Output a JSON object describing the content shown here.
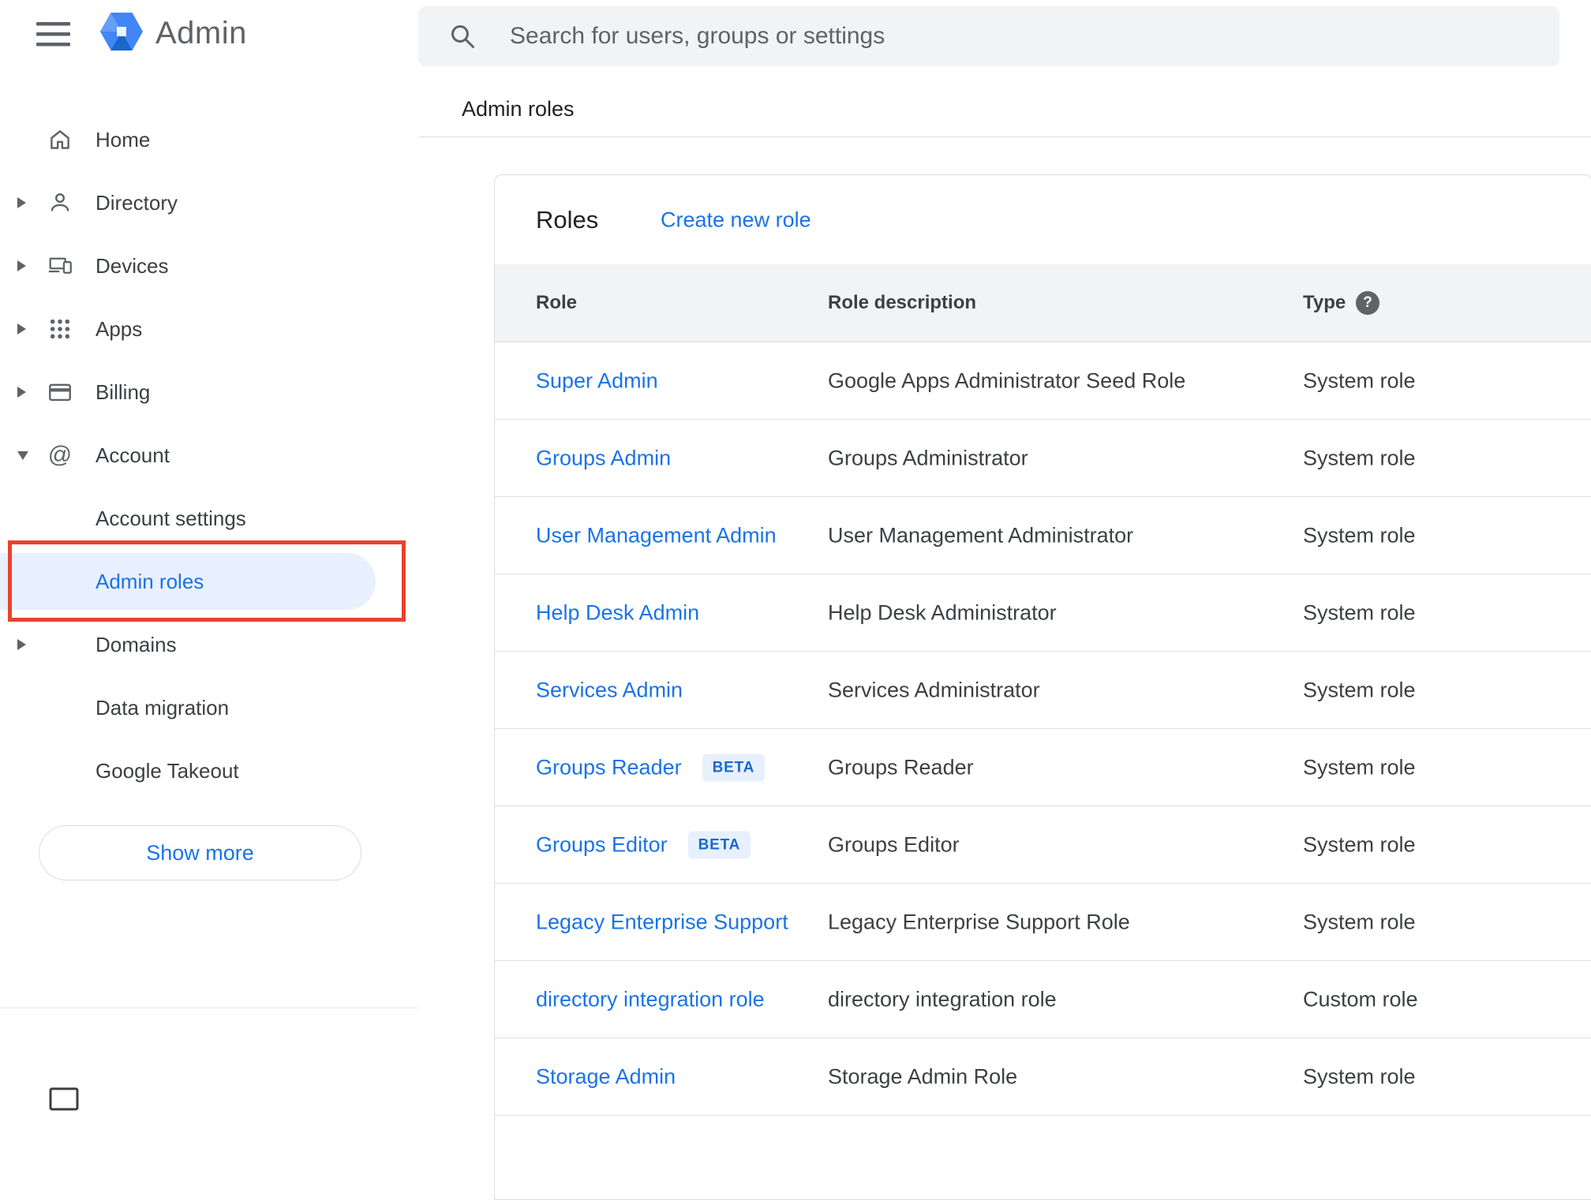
{
  "app": {
    "product_name": "Admin"
  },
  "header": {
    "search_placeholder": "Search for users, groups or settings",
    "breadcrumb": "Admin roles"
  },
  "sidebar": {
    "items": [
      {
        "label": "Home",
        "icon": "home-icon",
        "arrow": "none"
      },
      {
        "label": "Directory",
        "icon": "person-icon",
        "arrow": "right"
      },
      {
        "label": "Devices",
        "icon": "devices-icon",
        "arrow": "right"
      },
      {
        "label": "Apps",
        "icon": "apps-grid-icon",
        "arrow": "right"
      },
      {
        "label": "Billing",
        "icon": "credit-card-icon",
        "arrow": "right"
      },
      {
        "label": "Account",
        "icon": "at-sign-icon",
        "arrow": "down",
        "expanded": true
      }
    ],
    "account_children": [
      {
        "label": "Account settings"
      },
      {
        "label": "Admin roles",
        "selected": true,
        "annotated": true
      },
      {
        "label": "Domains",
        "arrow": "right"
      },
      {
        "label": "Data migration"
      },
      {
        "label": "Google Takeout"
      }
    ],
    "show_more": "Show more"
  },
  "roles_panel": {
    "title": "Roles",
    "create_link": "Create new role",
    "columns": {
      "role": "Role",
      "description": "Role description",
      "type": "Type"
    },
    "rows": [
      {
        "role": "Super Admin",
        "description": "Google Apps Administrator Seed Role",
        "type": "System role"
      },
      {
        "role": "Groups Admin",
        "description": "Groups Administrator",
        "type": "System role"
      },
      {
        "role": "User Management Admin",
        "description": "User Management Administrator",
        "type": "System role"
      },
      {
        "role": "Help Desk Admin",
        "description": "Help Desk Administrator",
        "type": "System role"
      },
      {
        "role": "Services Admin",
        "description": "Services Administrator",
        "type": "System role"
      },
      {
        "role": "Groups Reader",
        "badge": "BETA",
        "description": "Groups Reader",
        "type": "System role"
      },
      {
        "role": "Groups Editor",
        "badge": "BETA",
        "description": "Groups Editor",
        "type": "System role"
      },
      {
        "role": "Legacy Enterprise Support",
        "description": "Legacy Enterprise Support Role",
        "type": "System role"
      },
      {
        "role": "directory integration role",
        "description": "directory integration role",
        "type": "Custom role"
      },
      {
        "role": "Storage Admin",
        "description": "Storage Admin Role",
        "type": "System role"
      }
    ]
  },
  "annotation": {
    "shape": "rectangle",
    "color": "#e8432c",
    "target": "Admin roles sidebar item"
  },
  "colors": {
    "accent": "#1a73e8",
    "selected_bg": "#e8f0fe",
    "table_header_bg": "#f1f3f4",
    "search_bg": "#f1f3f4"
  }
}
